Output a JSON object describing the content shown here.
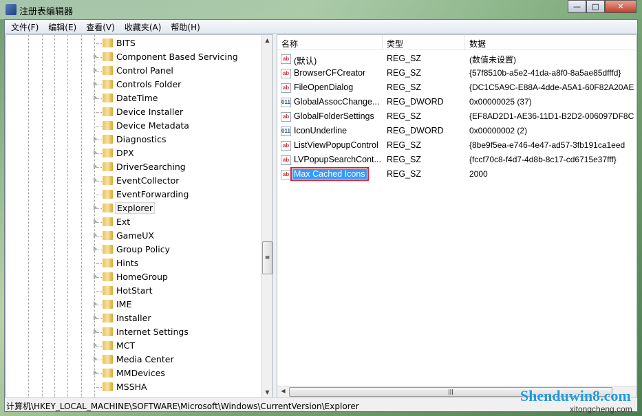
{
  "window": {
    "title": "注册表编辑器",
    "minimize": "—",
    "maximize": "□",
    "close": "✕"
  },
  "menu": [
    "文件(F)",
    "编辑(E)",
    "查看(V)",
    "收藏夹(A)",
    "帮助(H)"
  ],
  "tree": [
    {
      "label": "BITS",
      "expandable": false
    },
    {
      "label": "Component Based Servicing",
      "expandable": true
    },
    {
      "label": "Control Panel",
      "expandable": true
    },
    {
      "label": "Controls Folder",
      "expandable": true
    },
    {
      "label": "DateTime",
      "expandable": true
    },
    {
      "label": "Device Installer",
      "expandable": false
    },
    {
      "label": "Device Metadata",
      "expandable": false
    },
    {
      "label": "Diagnostics",
      "expandable": true
    },
    {
      "label": "DPX",
      "expandable": true
    },
    {
      "label": "DriverSearching",
      "expandable": true
    },
    {
      "label": "EventCollector",
      "expandable": true
    },
    {
      "label": "EventForwarding",
      "expandable": false
    },
    {
      "label": "Explorer",
      "expandable": true,
      "selected": true
    },
    {
      "label": "Ext",
      "expandable": true
    },
    {
      "label": "GameUX",
      "expandable": true
    },
    {
      "label": "Group Policy",
      "expandable": true
    },
    {
      "label": "Hints",
      "expandable": false
    },
    {
      "label": "HomeGroup",
      "expandable": true
    },
    {
      "label": "HotStart",
      "expandable": false
    },
    {
      "label": "IME",
      "expandable": true
    },
    {
      "label": "Installer",
      "expandable": true
    },
    {
      "label": "Internet Settings",
      "expandable": true
    },
    {
      "label": "MCT",
      "expandable": true
    },
    {
      "label": "Media Center",
      "expandable": true
    },
    {
      "label": "MMDevices",
      "expandable": true
    },
    {
      "label": "MSSHA",
      "expandable": false
    }
  ],
  "columns": {
    "name": "名称",
    "type": "类型",
    "data": "数据"
  },
  "values": [
    {
      "icon": "string-value-icon",
      "name": "(默认)",
      "type": "REG_SZ",
      "data": "(数值未设置)"
    },
    {
      "icon": "string-value-icon",
      "name": "BrowserCFCreator",
      "type": "REG_SZ",
      "data": "{57f8510b-a5e2-41da-a8f0-8a5ae85dfffd}"
    },
    {
      "icon": "string-value-icon",
      "name": "FileOpenDialog",
      "type": "REG_SZ",
      "data": "{DC1C5A9C-E88A-4dde-A5A1-60F82A20AE"
    },
    {
      "icon": "dword-value-icon",
      "name": "GlobalAssocChange...",
      "type": "REG_DWORD",
      "data": "0x00000025 (37)"
    },
    {
      "icon": "string-value-icon",
      "name": "GlobalFolderSettings",
      "type": "REG_SZ",
      "data": "{EF8AD2D1-AE36-11D1-B2D2-006097DF8C"
    },
    {
      "icon": "dword-value-icon",
      "name": "IconUnderline",
      "type": "REG_DWORD",
      "data": "0x00000002 (2)"
    },
    {
      "icon": "string-value-icon",
      "name": "ListViewPopupControl",
      "type": "REG_SZ",
      "data": "{8be9f5ea-e746-4e47-ad57-3fb191ca1eed"
    },
    {
      "icon": "string-value-icon",
      "name": "LVPopupSearchCont...",
      "type": "REG_SZ",
      "data": "{fccf70c8-f4d7-4d8b-8c17-cd6715e37fff}"
    },
    {
      "icon": "string-value-icon",
      "name": "Max Cached Icons",
      "type": "REG_SZ",
      "data": "2000",
      "selected": true
    }
  ],
  "icon_text": {
    "sz": "ab",
    "dword": "011"
  },
  "status": "计算机\\HKEY_LOCAL_MACHINE\\SOFTWARE\\Microsoft\\Windows\\CurrentVersion\\Explorer",
  "watermark": {
    "main": "Shenduwin8.com",
    "sub": "xitongcheng.com"
  },
  "colors": {
    "selection": "#3399ff",
    "highlight_box": "#e02030"
  }
}
